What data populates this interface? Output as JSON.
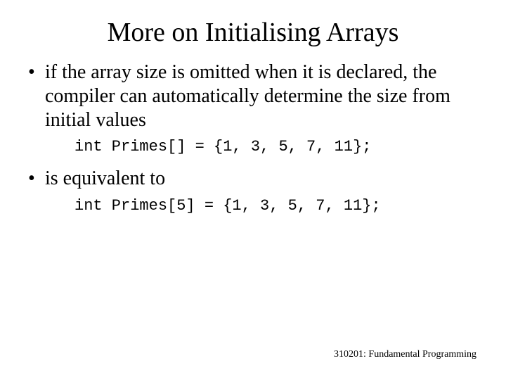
{
  "title": "More on Initialising Arrays",
  "bullets": {
    "b1": "if the array size is omitted when it is declared, the compiler can automatically determine the size from initial values",
    "b2": "is equivalent to"
  },
  "code": {
    "c1": "int Primes[] = {1, 3, 5, 7, 11};",
    "c2": "int Primes[5] = {1, 3, 5, 7, 11};"
  },
  "footer": "310201: Fundamental Programming"
}
